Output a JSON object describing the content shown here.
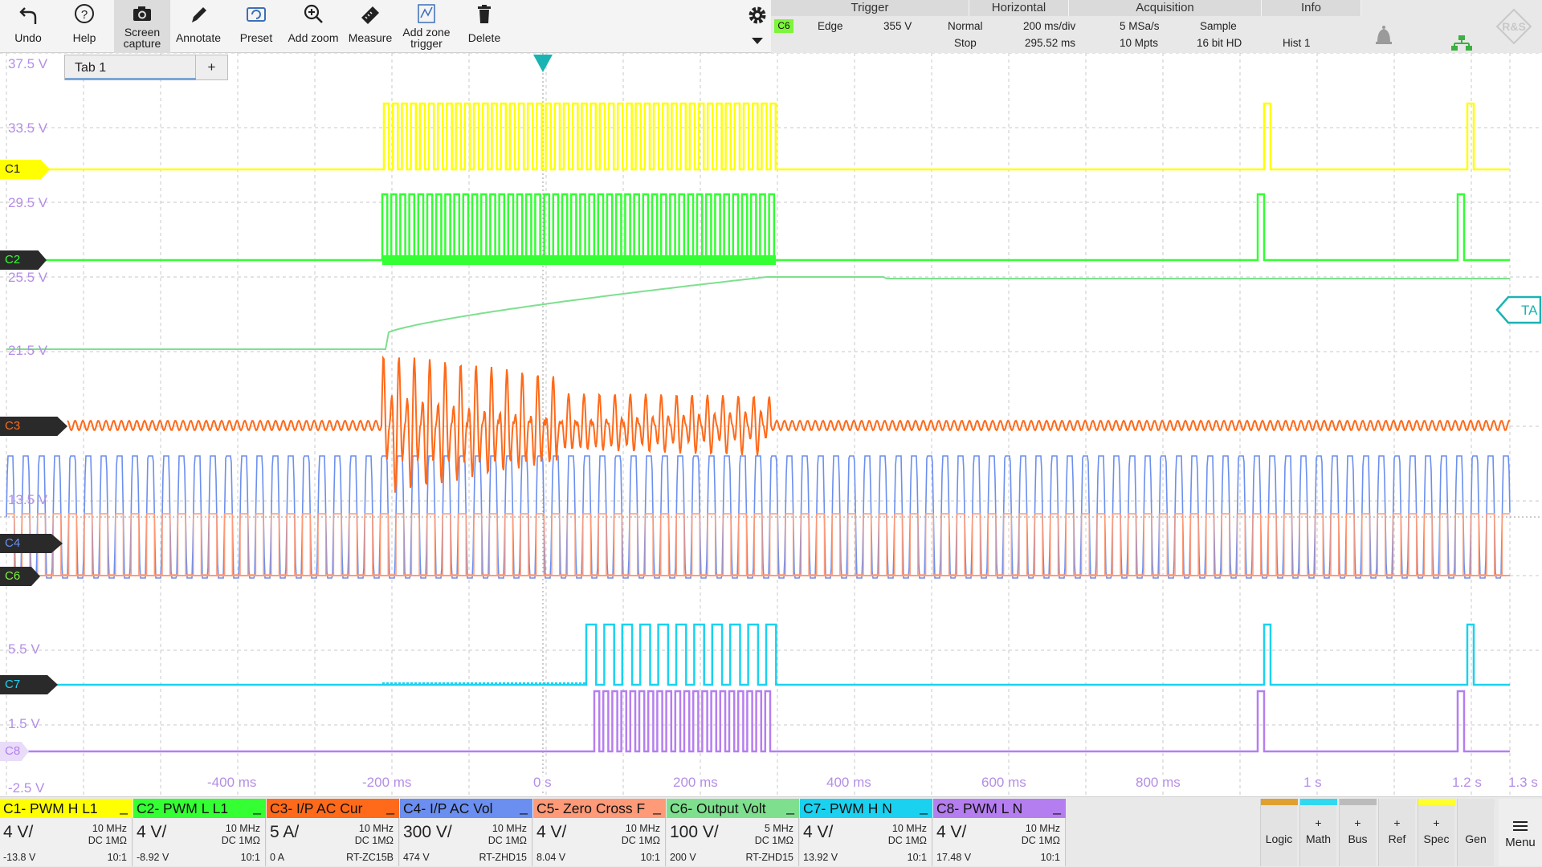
{
  "toolbar": {
    "undo": "Undo",
    "help": "Help",
    "screen_capture_1": "Screen",
    "screen_capture_2": "capture",
    "annotate": "Annotate",
    "preset": "Preset",
    "add_zoom": "Add zoom",
    "measure": "Measure",
    "add_zone_1": "Add zone",
    "add_zone_2": "trigger",
    "delete": "Delete"
  },
  "status": {
    "trigger_header": "Trigger",
    "horizontal_header": "Horizontal",
    "acquisition_header": "Acquisition",
    "info_header": "Info",
    "trigger_source": "C6",
    "trigger_type": "Edge",
    "trigger_level": "355 V",
    "trigger_mode": "Normal",
    "run_state": "Stop",
    "time_scale": "200 ms/div",
    "time_position": "295.52 ms",
    "sample_rate": "5 MSa/s",
    "record_length": "10 Mpts",
    "acq_mode": "Sample",
    "resolution": "16 bit HD",
    "history": "Hist 1"
  },
  "tab": {
    "name": "Tab 1",
    "add": "+"
  },
  "y_axis_labels": [
    "37.5 V",
    "33.5 V",
    "29.5 V",
    "25.5 V",
    "21.5 V",
    "13.5 V",
    "5.5 V",
    "1.5 V",
    "-2.5 V"
  ],
  "x_axis_labels": [
    "-400 ms",
    "-200 ms",
    "0 s",
    "200 ms",
    "400 ms",
    "600 ms",
    "800 ms",
    "1 s",
    "1.2 s",
    "1.3 s"
  ],
  "markers": {
    "c1": "C1",
    "c2": "C2",
    "c3": "C3",
    "c4": "C4",
    "c6": "C6",
    "c7": "C7",
    "c8": "C8",
    "ta": "TA"
  },
  "channels": [
    {
      "title": "C1- PWM H L1",
      "scale": "4 V/",
      "bw": "10 MHz",
      "coupling": "DC 1MΩ",
      "offset": "-13.8 V",
      "probe": "10:1",
      "color": "#ffff00"
    },
    {
      "title": "C2- PWM L L1",
      "scale": "4 V/",
      "bw": "10 MHz",
      "coupling": "DC 1MΩ",
      "offset": "-8.92 V",
      "probe": "10:1",
      "color": "#33ff33"
    },
    {
      "title": "C3- I/P AC Cur",
      "scale": "5 A/",
      "bw": "10 MHz",
      "coupling": "DC 1MΩ",
      "offset": "0 A",
      "probe": "RT-ZC15B",
      "color": "#ff6a1a"
    },
    {
      "title": "C4- I/P AC Vol",
      "scale": "300 V/",
      "bw": "10 MHz",
      "coupling": "DC 1MΩ",
      "offset": "474 V",
      "probe": "RT-ZHD15",
      "color": "#6b8ff0"
    },
    {
      "title": "C5- Zero Cross F",
      "scale": "4 V/",
      "bw": "10 MHz",
      "coupling": "DC 1MΩ",
      "offset": "8.04 V",
      "probe": "10:1",
      "color": "#ff9a78"
    },
    {
      "title": "C6- Output Volt",
      "scale": "100 V/",
      "bw": "5 MHz",
      "coupling": "DC 1MΩ",
      "offset": "200 V",
      "probe": "RT-ZHD15",
      "color": "#7ee08e"
    },
    {
      "title": "C7- PWM H N",
      "scale": "4 V/",
      "bw": "10 MHz",
      "coupling": "DC 1MΩ",
      "offset": "13.92 V",
      "probe": "10:1",
      "color": "#1ad2f0"
    },
    {
      "title": "C8- PWM L N",
      "scale": "4 V/",
      "bw": "10 MHz",
      "coupling": "DC 1MΩ",
      "offset": "17.48 V",
      "probe": "10:1",
      "color": "#b57ef0"
    }
  ],
  "function_buttons": [
    {
      "label": "Logic",
      "plus": "",
      "color": "#e0a030"
    },
    {
      "label": "Math",
      "plus": "+",
      "color": "#30d8f0"
    },
    {
      "label": "Bus",
      "plus": "+",
      "color": "#bbbbbb"
    },
    {
      "label": "Ref",
      "plus": "+",
      "color": "#e3e3e3"
    },
    {
      "label": "Spec",
      "plus": "+",
      "color": "#ffff30"
    },
    {
      "label": "Gen",
      "plus": "",
      "color": "#e3e3e3"
    }
  ],
  "menu": "Menu",
  "icons": [
    "undo-icon",
    "help-icon",
    "camera-icon",
    "pen-icon",
    "preset-icon",
    "zoom-icon",
    "ruler-icon",
    "zone-icon",
    "trash-icon",
    "gear-icon",
    "chevron-down-icon",
    "alert-icon",
    "network-icon",
    "logo-icon",
    "menu-icon"
  ]
}
